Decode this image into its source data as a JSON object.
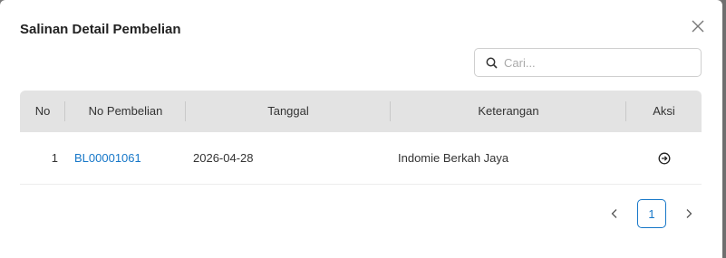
{
  "modal": {
    "title": "Salinan Detail Pembelian"
  },
  "search": {
    "placeholder": "Cari..."
  },
  "table": {
    "columns": [
      "No",
      "No Pembelian",
      "Tanggal",
      "Keterangan",
      "Aksi"
    ],
    "rows": [
      {
        "no": "1",
        "no_pembelian": "BL00001061",
        "tanggal": "2026-04-28",
        "keterangan": "Indomie Berkah Jaya",
        "aksi_icon": "arrow-right-circle-icon"
      }
    ]
  },
  "pagination": {
    "current_page": "1"
  },
  "colors": {
    "link": "#1677c8",
    "header_bg": "#e3e3e3"
  }
}
